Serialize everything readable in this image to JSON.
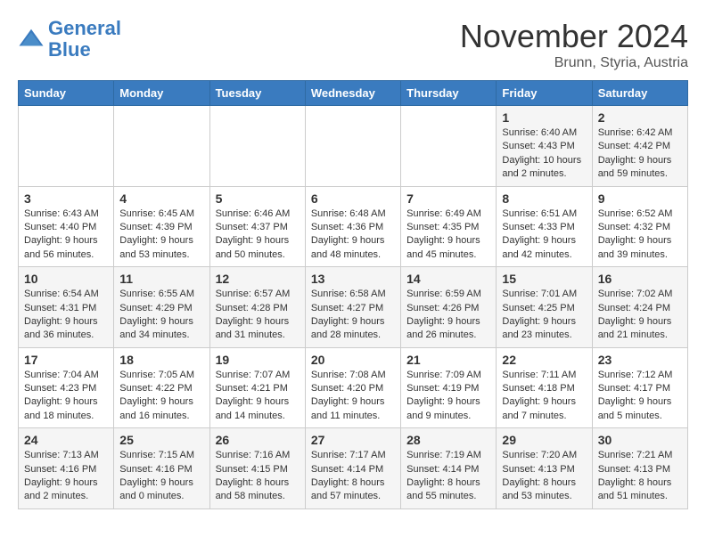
{
  "logo": {
    "line1": "General",
    "line2": "Blue"
  },
  "title": "November 2024",
  "subtitle": "Brunn, Styria, Austria",
  "days_header": [
    "Sunday",
    "Monday",
    "Tuesday",
    "Wednesday",
    "Thursday",
    "Friday",
    "Saturday"
  ],
  "weeks": [
    [
      {
        "num": "",
        "detail": ""
      },
      {
        "num": "",
        "detail": ""
      },
      {
        "num": "",
        "detail": ""
      },
      {
        "num": "",
        "detail": ""
      },
      {
        "num": "",
        "detail": ""
      },
      {
        "num": "1",
        "detail": "Sunrise: 6:40 AM\nSunset: 4:43 PM\nDaylight: 10 hours\nand 2 minutes."
      },
      {
        "num": "2",
        "detail": "Sunrise: 6:42 AM\nSunset: 4:42 PM\nDaylight: 9 hours\nand 59 minutes."
      }
    ],
    [
      {
        "num": "3",
        "detail": "Sunrise: 6:43 AM\nSunset: 4:40 PM\nDaylight: 9 hours\nand 56 minutes."
      },
      {
        "num": "4",
        "detail": "Sunrise: 6:45 AM\nSunset: 4:39 PM\nDaylight: 9 hours\nand 53 minutes."
      },
      {
        "num": "5",
        "detail": "Sunrise: 6:46 AM\nSunset: 4:37 PM\nDaylight: 9 hours\nand 50 minutes."
      },
      {
        "num": "6",
        "detail": "Sunrise: 6:48 AM\nSunset: 4:36 PM\nDaylight: 9 hours\nand 48 minutes."
      },
      {
        "num": "7",
        "detail": "Sunrise: 6:49 AM\nSunset: 4:35 PM\nDaylight: 9 hours\nand 45 minutes."
      },
      {
        "num": "8",
        "detail": "Sunrise: 6:51 AM\nSunset: 4:33 PM\nDaylight: 9 hours\nand 42 minutes."
      },
      {
        "num": "9",
        "detail": "Sunrise: 6:52 AM\nSunset: 4:32 PM\nDaylight: 9 hours\nand 39 minutes."
      }
    ],
    [
      {
        "num": "10",
        "detail": "Sunrise: 6:54 AM\nSunset: 4:31 PM\nDaylight: 9 hours\nand 36 minutes."
      },
      {
        "num": "11",
        "detail": "Sunrise: 6:55 AM\nSunset: 4:29 PM\nDaylight: 9 hours\nand 34 minutes."
      },
      {
        "num": "12",
        "detail": "Sunrise: 6:57 AM\nSunset: 4:28 PM\nDaylight: 9 hours\nand 31 minutes."
      },
      {
        "num": "13",
        "detail": "Sunrise: 6:58 AM\nSunset: 4:27 PM\nDaylight: 9 hours\nand 28 minutes."
      },
      {
        "num": "14",
        "detail": "Sunrise: 6:59 AM\nSunset: 4:26 PM\nDaylight: 9 hours\nand 26 minutes."
      },
      {
        "num": "15",
        "detail": "Sunrise: 7:01 AM\nSunset: 4:25 PM\nDaylight: 9 hours\nand 23 minutes."
      },
      {
        "num": "16",
        "detail": "Sunrise: 7:02 AM\nSunset: 4:24 PM\nDaylight: 9 hours\nand 21 minutes."
      }
    ],
    [
      {
        "num": "17",
        "detail": "Sunrise: 7:04 AM\nSunset: 4:23 PM\nDaylight: 9 hours\nand 18 minutes."
      },
      {
        "num": "18",
        "detail": "Sunrise: 7:05 AM\nSunset: 4:22 PM\nDaylight: 9 hours\nand 16 minutes."
      },
      {
        "num": "19",
        "detail": "Sunrise: 7:07 AM\nSunset: 4:21 PM\nDaylight: 9 hours\nand 14 minutes."
      },
      {
        "num": "20",
        "detail": "Sunrise: 7:08 AM\nSunset: 4:20 PM\nDaylight: 9 hours\nand 11 minutes."
      },
      {
        "num": "21",
        "detail": "Sunrise: 7:09 AM\nSunset: 4:19 PM\nDaylight: 9 hours\nand 9 minutes."
      },
      {
        "num": "22",
        "detail": "Sunrise: 7:11 AM\nSunset: 4:18 PM\nDaylight: 9 hours\nand 7 minutes."
      },
      {
        "num": "23",
        "detail": "Sunrise: 7:12 AM\nSunset: 4:17 PM\nDaylight: 9 hours\nand 5 minutes."
      }
    ],
    [
      {
        "num": "24",
        "detail": "Sunrise: 7:13 AM\nSunset: 4:16 PM\nDaylight: 9 hours\nand 2 minutes."
      },
      {
        "num": "25",
        "detail": "Sunrise: 7:15 AM\nSunset: 4:16 PM\nDaylight: 9 hours\nand 0 minutes."
      },
      {
        "num": "26",
        "detail": "Sunrise: 7:16 AM\nSunset: 4:15 PM\nDaylight: 8 hours\nand 58 minutes."
      },
      {
        "num": "27",
        "detail": "Sunrise: 7:17 AM\nSunset: 4:14 PM\nDaylight: 8 hours\nand 57 minutes."
      },
      {
        "num": "28",
        "detail": "Sunrise: 7:19 AM\nSunset: 4:14 PM\nDaylight: 8 hours\nand 55 minutes."
      },
      {
        "num": "29",
        "detail": "Sunrise: 7:20 AM\nSunset: 4:13 PM\nDaylight: 8 hours\nand 53 minutes."
      },
      {
        "num": "30",
        "detail": "Sunrise: 7:21 AM\nSunset: 4:13 PM\nDaylight: 8 hours\nand 51 minutes."
      }
    ]
  ]
}
